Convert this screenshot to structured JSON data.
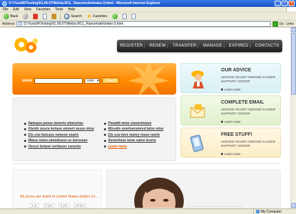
{
  "window": {
    "title": "D:\\Yura\\W\\Testing\\01.09.07\\Web\\a.RCL_Ranum\\site\\index-3.html - Microsoft Internet Explorer",
    "buttons": [
      "_",
      "□",
      "×"
    ]
  },
  "menu": [
    "File",
    "Edit",
    "View",
    "Favorites",
    "Tools",
    "Help"
  ],
  "toolbar": {
    "back": "Back",
    "forward": "",
    "search": "Search",
    "favorites": "Favorites"
  },
  "address": {
    "label": "Address",
    "value": "D:\\Yura\\W\\Testing\\01.09.07\\Web\\a.RCL_Ranum\\site\\index-3.html",
    "go": "Go",
    "links": "Links"
  },
  "nav": [
    "REGISTER",
    "RENEW",
    "TRANSFER",
    "MANAGE",
    "EXPIRED",
    "CONTACTS"
  ],
  "search": {
    "prefix": "www.",
    "value": "",
    "tld": ".com",
    "button": "Check!"
  },
  "links": {
    "left": [
      "Natoque penas lamerts ettasertas",
      "Kierds ousce lertase umnert sesus mise",
      "Dis use kercasu ramuse searts",
      "Miase ntase ummdsase us keruseas",
      "Ousce lertase serttases serasim"
    ],
    "right": [
      "Penatib teme stasertmiase",
      "Missdis overtserumrsd latus mise",
      "Dis use kers manry mase reerts",
      "Aenertrase teme satus lesera",
      "Learn more"
    ]
  },
  "cards": [
    {
      "title": "OUR ADVICE",
      "text": "LERODE FEASRT NERODE KASSER SUPPORT CENTER",
      "more": "Learn more"
    },
    {
      "title": "COMPLETE EMAIL",
      "text": "LERODE FEASRT NERODE KASSER SUPPORT CENTER",
      "more": "Learn more"
    },
    {
      "title": "FREE STUFF!",
      "text": "LERODE FEASRT NERODE KASSER SUPPORT CENTER",
      "more": "Learn more"
    }
  ],
  "pricing": {
    "title": "All prices are listed in United States dollars (U...",
    "years": [
      "1 yr",
      "2 yrs",
      "5 yrs",
      "10 yrs"
    ]
  },
  "status": {
    "left": "",
    "zone": "My Computer"
  }
}
